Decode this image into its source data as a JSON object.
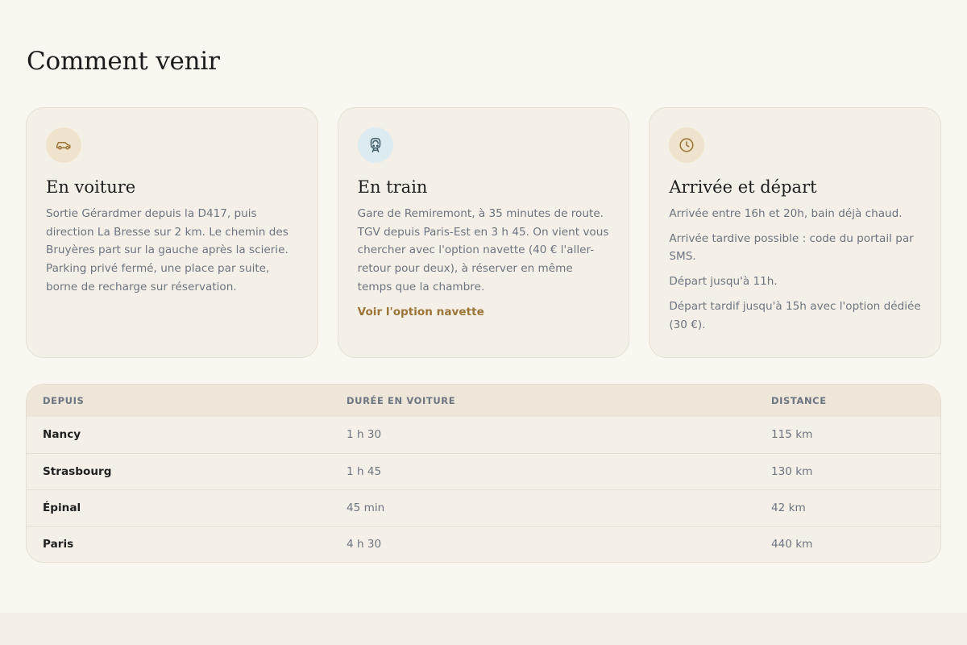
{
  "page": {
    "title": "Comment venir"
  },
  "cards": {
    "car": {
      "icon": "car-icon",
      "title": "En voiture",
      "text": "Sortie Gérardmer depuis la D417, puis direction La Bresse sur 2 km. Le chemin des Bruyères part sur la gauche après la scierie. Parking privé fermé, une place par suite, borne de recharge sur réservation."
    },
    "train": {
      "icon": "train-icon",
      "title": "En train",
      "text": "Gare de Remiremont, à 35 minutes de route. TGV depuis Paris-Est en 3 h 45. On vient vous chercher avec l'option navette (40 € l'aller-retour pour deux), à réserver en même temps que la chambre.",
      "link": "Voir l'option navette"
    },
    "arrival": {
      "icon": "clock-icon",
      "title": "Arrivée et départ",
      "paragraphs": [
        "Arrivée entre 16h et 20h, bain déjà chaud.",
        "Arrivée tardive possible : code du portail par SMS.",
        "Départ jusqu'à 11h.",
        "Départ tardif jusqu'à 15h avec l'option dédiée (30 €)."
      ]
    }
  },
  "table": {
    "headers": [
      "DEPUIS",
      "DURÉE EN VOITURE",
      "DISTANCE"
    ],
    "rows": [
      {
        "city": "Nancy",
        "duration": "1 h 30",
        "distance": "115 km"
      },
      {
        "city": "Strasbourg",
        "duration": "1 h 45",
        "distance": "130 km"
      },
      {
        "city": "Épinal",
        "duration": "45 min",
        "distance": "42 km"
      },
      {
        "city": "Paris",
        "duration": "4 h 30",
        "distance": "440 km"
      }
    ]
  },
  "colors": {
    "background": "#faf7f0",
    "card": "#f4f0e8",
    "accent_link": "#9b7438",
    "icon_warm": "#f0e3cb",
    "icon_cool": "#dcebf0"
  }
}
